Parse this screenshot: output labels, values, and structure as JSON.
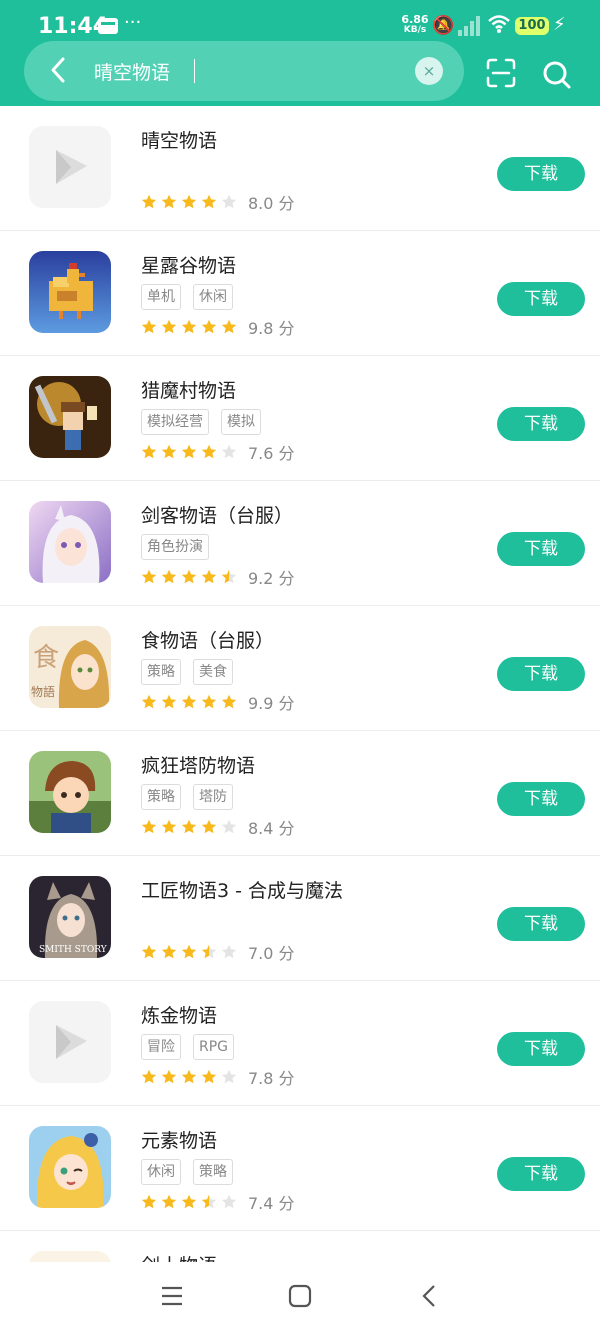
{
  "status_bar": {
    "time": "11:44",
    "dots": "···",
    "speed_value": "6.86",
    "speed_unit": "KB/s",
    "battery": "100"
  },
  "search": {
    "query": "晴空物语",
    "clear_symbol": "×"
  },
  "colors": {
    "accent": "#1fbf9c",
    "star_filled": "#f8b91c",
    "star_empty": "#e4e4e4"
  },
  "download_label": "下载",
  "results": [
    {
      "name": "晴空物语",
      "tags": [],
      "stars": 4,
      "score": "8.0 分",
      "icon": "placeholder-icon"
    },
    {
      "name": "星露谷物语",
      "tags": [
        "单机",
        "休闲"
      ],
      "stars": 5,
      "score": "9.8 分",
      "icon": "chicken-icon"
    },
    {
      "name": "猎魔村物语",
      "tags": [
        "模拟经营",
        "模拟"
      ],
      "stars": 4,
      "score": "7.6 分",
      "icon": "pixel-knight-icon"
    },
    {
      "name": "剑客物语（台服）",
      "tags": [
        "角色扮演"
      ],
      "stars": 4.5,
      "score": "9.2 分",
      "icon": "anime-girl-icon"
    },
    {
      "name": "食物语（台服）",
      "tags": [
        "策略",
        "美食"
      ],
      "stars": 5,
      "score": "9.9 分",
      "icon": "anime-boy-icon"
    },
    {
      "name": "疯狂塔防物语",
      "tags": [
        "策略",
        "塔防"
      ],
      "stars": 4,
      "score": "8.4 分",
      "icon": "boy-hero-icon"
    },
    {
      "name": "工匠物语3 - 合成与魔法",
      "tags": [],
      "stars": 3.5,
      "score": "7.0 分",
      "icon": "smith-story-icon"
    },
    {
      "name": "炼金物语",
      "tags": [
        "冒险",
        "RPG"
      ],
      "stars": 4,
      "score": "7.8 分",
      "icon": "placeholder-icon"
    },
    {
      "name": "元素物语",
      "tags": [
        "休闲",
        "策略"
      ],
      "stars": 3.5,
      "score": "7.4 分",
      "icon": "blonde-girl-icon"
    },
    {
      "name": "剑士物语",
      "tags": [],
      "stars": null,
      "score": null,
      "icon": "partial-icon"
    }
  ],
  "nav": [
    "menu-icon",
    "home-icon",
    "back-icon"
  ]
}
